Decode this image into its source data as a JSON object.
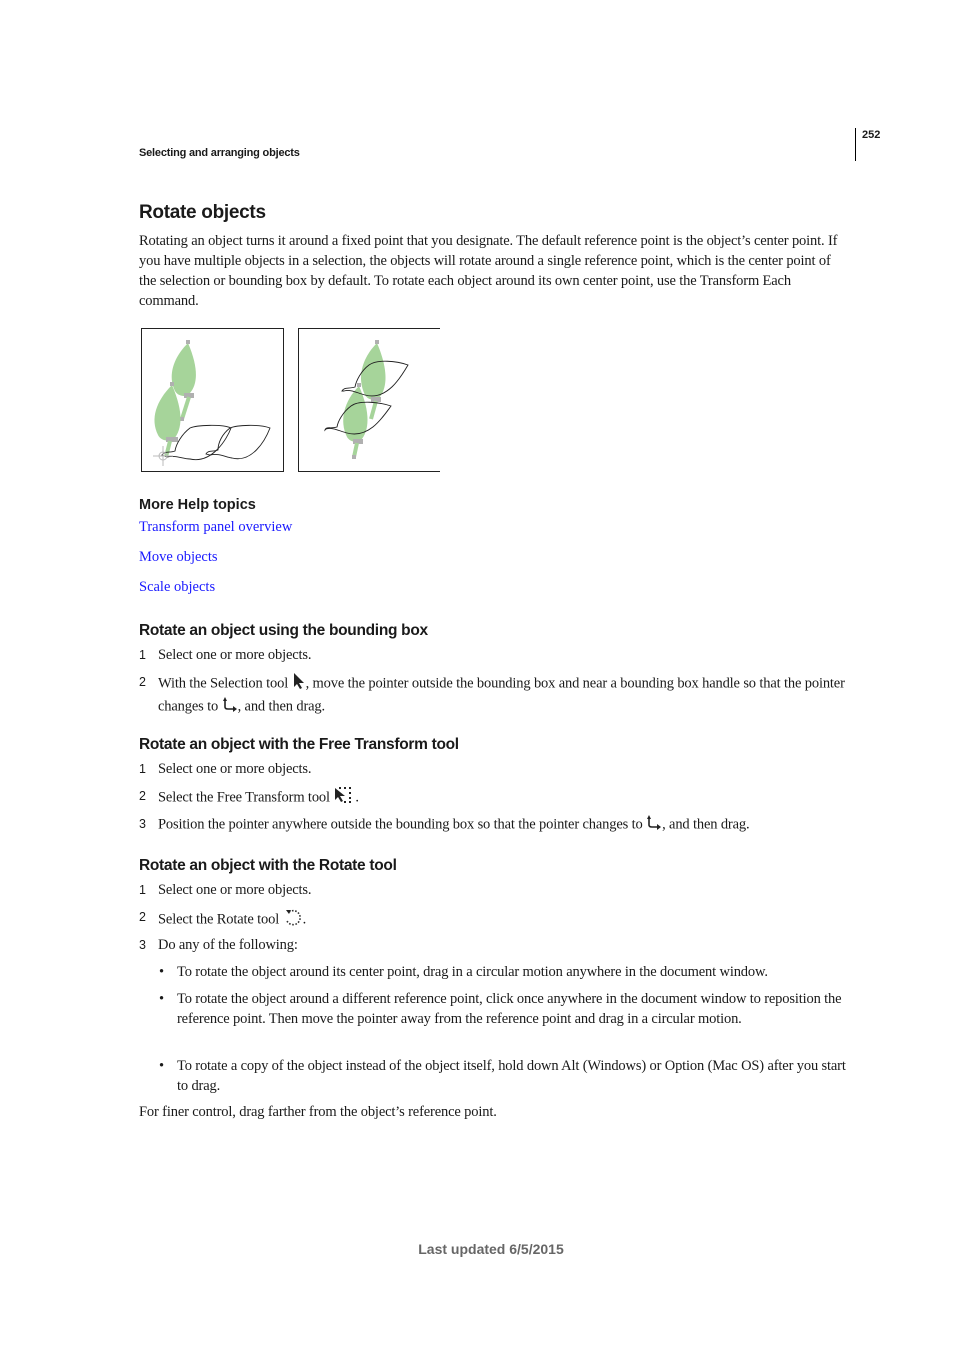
{
  "header": {
    "running_head": "Selecting and arranging objects",
    "page_number": "252"
  },
  "section": {
    "title": "Rotate objects",
    "intro": "Rotating an object turns it around a fixed point that you designate. The default reference point is the object’s center point. If you have multiple objects in a selection, the objects will rotate around a single reference point, which is the center point of the selection or bounding box by default. To rotate each object around its own center point, use the Transform Each command."
  },
  "figures": [
    {
      "name": "rotate-around-single-reference-point"
    },
    {
      "name": "rotate-each-around-own-center"
    }
  ],
  "colors": {
    "link": "#1a1aff",
    "leaf_fill": "#a6d49a",
    "handle": "#b0b0b0",
    "footer": "#666666"
  },
  "more_help": {
    "title": "More Help topics",
    "links": [
      {
        "label": "Transform panel overview"
      },
      {
        "label": "Move objects"
      },
      {
        "label": "Scale objects"
      }
    ]
  },
  "subsections": [
    {
      "title": "Rotate an object using the bounding box",
      "steps": [
        {
          "num": "1",
          "text": "Select one or more objects."
        },
        {
          "num": "2",
          "text_before": "With the Selection tool",
          "icon": "selection-tool-icon",
          "text_after": ", move the pointer outside the bounding box and near a bounding box handle so that the pointer changes to",
          "icon2": "rotate-cursor-icon",
          "text_end": ", and then drag."
        }
      ]
    },
    {
      "title": "Rotate an object with the Free Transform tool",
      "steps": [
        {
          "num": "1",
          "text": "Select one or more objects."
        },
        {
          "num": "2",
          "text_before": "Select the Free Transform tool",
          "icon": "free-transform-tool-icon",
          "text_after": "."
        },
        {
          "num": "3",
          "text_before": "Position the pointer anywhere outside the bounding box so that the pointer changes to",
          "icon": "rotate-cursor-icon",
          "text_after": ", and then drag."
        }
      ]
    },
    {
      "title": "Rotate an object with the Rotate tool",
      "steps": [
        {
          "num": "1",
          "text": "Select one or more objects."
        },
        {
          "num": "2",
          "text_before": "Select the Rotate tool",
          "icon": "rotate-tool-icon",
          "text_after": "."
        },
        {
          "num": "3",
          "text": "Do any of the following:"
        }
      ],
      "bullets": [
        "To rotate the object around its center point, drag in a circular motion anywhere in the document window.",
        "To rotate the object around a different reference point, click once anywhere in the document window to reposition the reference point. Then move the pointer away from the reference point and drag in a circular motion.",
        "To rotate a copy of the object instead of the object itself, hold down Alt (Windows) or Option (Mac OS) after you start to drag."
      ],
      "bullet_symbol": "•",
      "closing": "For finer control, drag farther from the object’s reference point."
    }
  ],
  "footer": {
    "text": "Last updated 6/5/2015"
  }
}
